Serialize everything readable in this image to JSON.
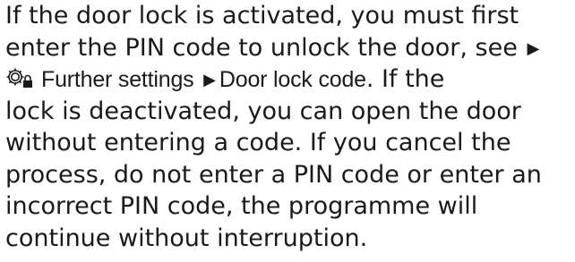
{
  "paragraph": {
    "line1": "If the door lock is activated, you must first",
    "line2": "enter the PIN code to unlock the door, see",
    "line3_path_1": "Further settings",
    "line3_path_2": "Door lock code",
    "line3_rest": ". If the",
    "line4": "lock is deactivated, you can open the door",
    "line5": "without entering a code. If you cancel the",
    "line6": "process, do not enter a PIN code or enter an",
    "line7": "incorrect PIN code, the programme will",
    "line8": "continue without interruption."
  },
  "icons": {
    "arrow": "triangle-right-icon",
    "settings": "gear-with-lock-icon"
  }
}
